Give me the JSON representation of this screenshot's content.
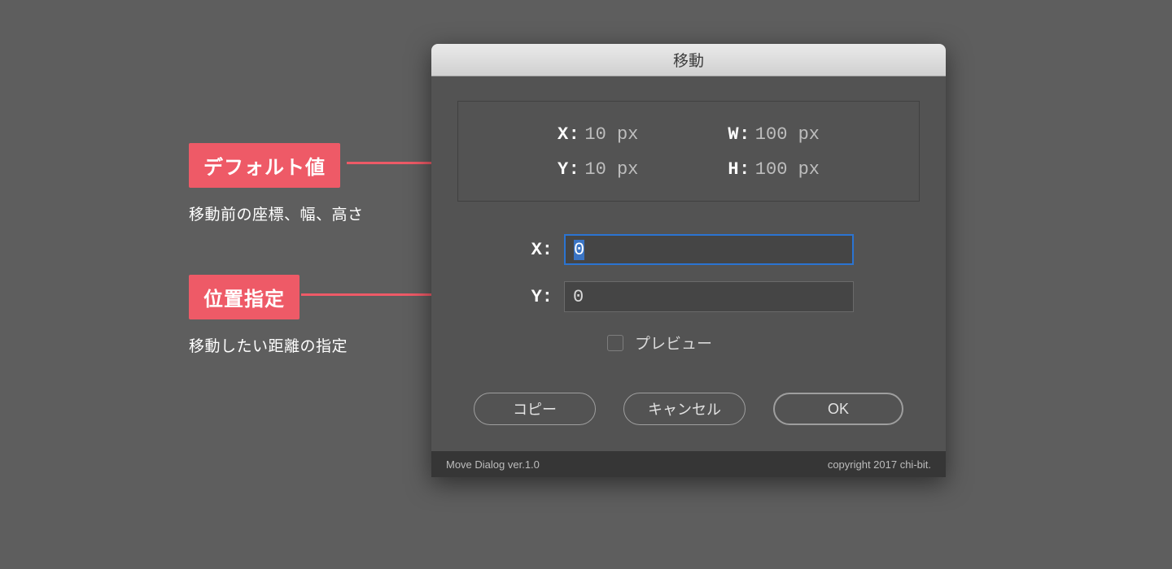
{
  "dialog": {
    "title": "移動",
    "defaults": {
      "x_label": "X:",
      "x_value": "10 px",
      "y_label": "Y:",
      "y_value": "10 px",
      "w_label": "W:",
      "w_value": "100 px",
      "h_label": "H:",
      "h_value": "100 px"
    },
    "inputs": {
      "x_label": "X:",
      "x_value": "0",
      "y_label": "Y:",
      "y_value": "0"
    },
    "preview_label": "プレビュー",
    "buttons": {
      "copy": "コピー",
      "cancel": "キャンセル",
      "ok": "OK"
    },
    "footer": {
      "left": "Move Dialog ver.1.0",
      "right": "copyright 2017 chi-bit."
    }
  },
  "callouts": {
    "default": {
      "tag": "デフォルト値",
      "desc": "移動前の座標、幅、高さ"
    },
    "position": {
      "tag": "位置指定",
      "desc": "移動したい距離の指定"
    }
  }
}
